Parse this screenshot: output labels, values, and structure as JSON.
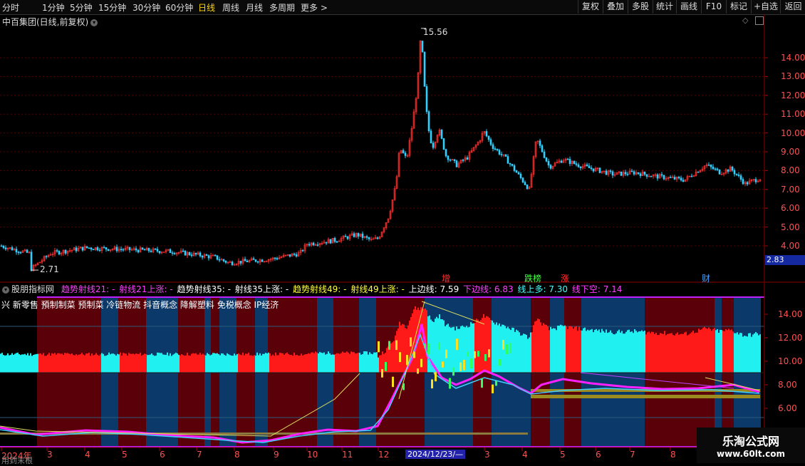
{
  "toolbar": {
    "timeframes": [
      "分时",
      "1分钟",
      "5分钟",
      "15分钟",
      "30分钟",
      "60分钟",
      "日线",
      "周线",
      "月线",
      "多周期"
    ],
    "active_timeframe": "日线",
    "more_label": "更多 >",
    "right_buttons": [
      "复权",
      "叠加",
      "多股",
      "统计",
      "画线",
      "F10",
      "标记",
      "+自选",
      "返回"
    ]
  },
  "main_chart": {
    "title": "中百集团(日线,前复权)",
    "price_axis": [
      "14.00",
      "13.00",
      "12.00",
      "11.00",
      "10.00",
      "9.00",
      "8.00",
      "7.00",
      "6.00",
      "5.00",
      "4.00"
    ],
    "high_label": "15.56",
    "low_label": "2.71",
    "current_price_badge": "2.83"
  },
  "events": [
    {
      "label": "增",
      "color": "#ff3030"
    },
    {
      "label": "跌榜",
      "color": "#40ff40"
    },
    {
      "label": "涨",
      "color": "#ff3030"
    },
    {
      "label": "财",
      "color": "#40a0ff"
    }
  ],
  "indicator": {
    "name": "股朋指标网",
    "values": [
      {
        "text": "趋势射线21: -",
        "color": "#ff40ff"
      },
      {
        "text": "射线21上涨: -",
        "color": "#ff40ff"
      },
      {
        "text": "趋势射线35: -",
        "color": "#ffffff"
      },
      {
        "text": "射线35上涨: -",
        "color": "#ffffff"
      },
      {
        "text": "趋势射线49: -",
        "color": "#ffff40"
      },
      {
        "text": "射线49上涨: -",
        "color": "#ffff40"
      },
      {
        "text": "上边线: 7.59",
        "color": "#ffffff"
      },
      {
        "text": "下边线: 6.83",
        "color": "#ff40ff"
      },
      {
        "text": "线上多: 7.30",
        "color": "#40ffff"
      },
      {
        "text": "线下空: 7.14",
        "color": "#ff40ff"
      }
    ],
    "concepts": "兴 新零售 預制制菜 预制菜 冷链物流 抖音概念 降解塑料 免税概念 IP经济",
    "price_axis": [
      "14.00",
      "12.00",
      "10.00",
      "8.00",
      "6.00"
    ]
  },
  "x_axis": {
    "labels": [
      "2024年",
      "3",
      "4",
      "5",
      "6",
      "7",
      "8",
      "9",
      "10",
      "11",
      "12",
      "1",
      "3",
      "4",
      "5",
      "6",
      "7",
      "8"
    ],
    "date_badge": "2024/12/23/—"
  },
  "bottom_left_text": "用到末根",
  "watermark": {
    "line1": "乐淘公式网",
    "line2": "www.60lt.com"
  }
}
